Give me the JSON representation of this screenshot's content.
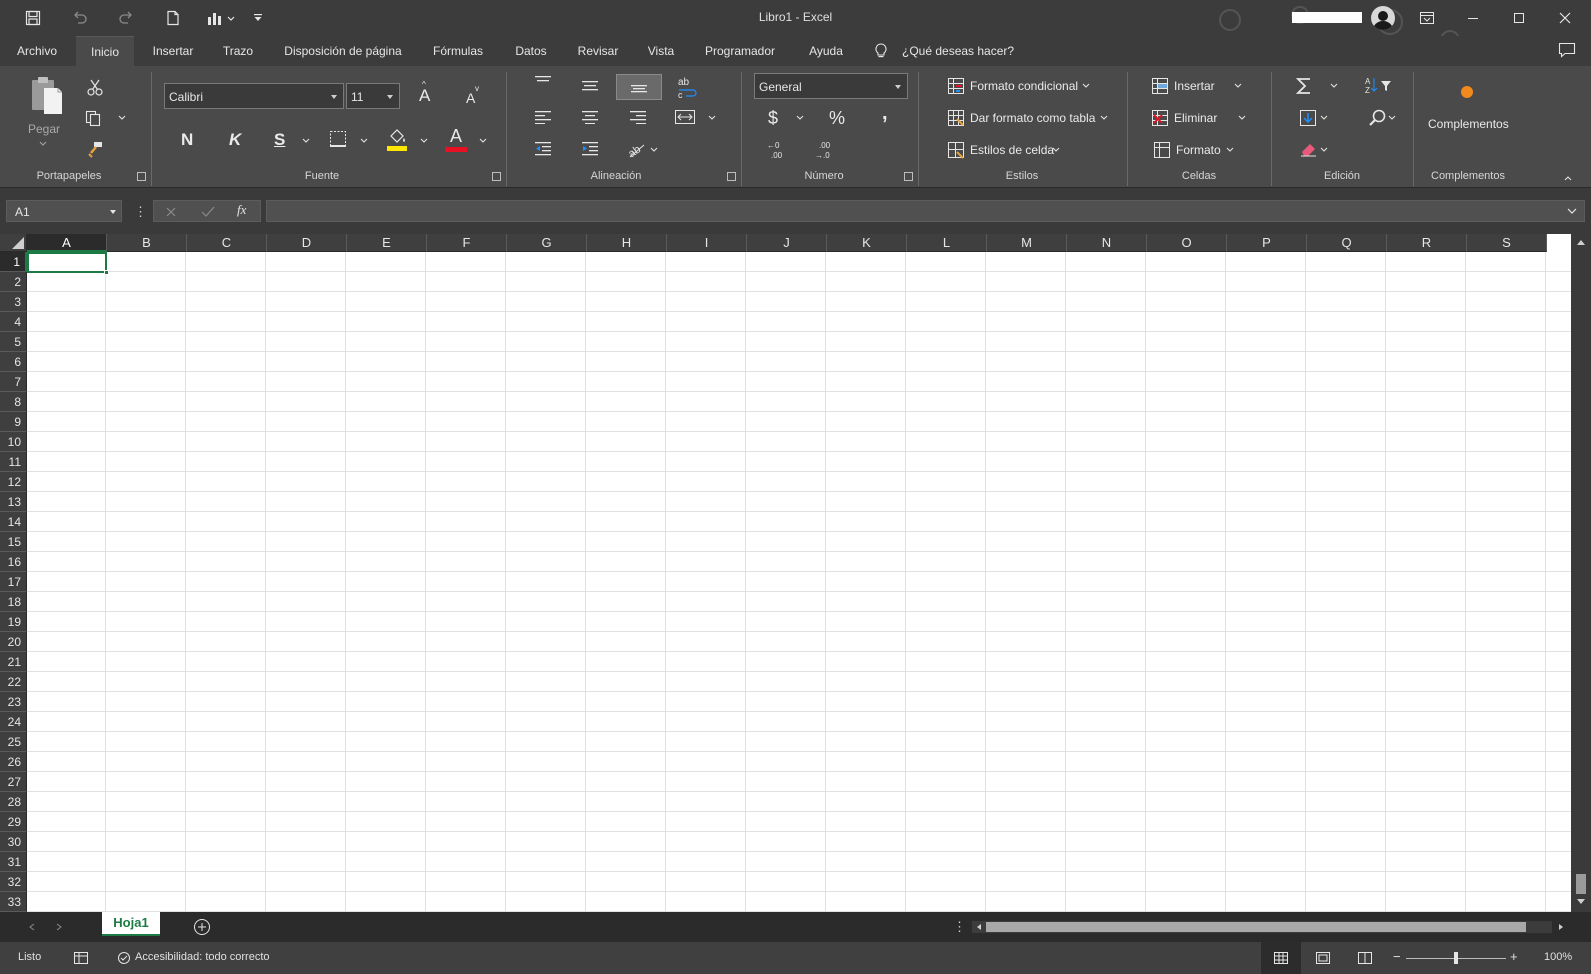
{
  "window": {
    "title": "Libro1  -  Excel"
  },
  "menu": {
    "tabs": [
      "Archivo",
      "Inicio",
      "Insertar",
      "Trazo",
      "Disposición de página",
      "Fórmulas",
      "Datos",
      "Revisar",
      "Vista",
      "Programador",
      "Ayuda"
    ],
    "active": "Inicio",
    "tell_me": "¿Qué deseas hacer?"
  },
  "ribbon": {
    "clipboard": {
      "label": "Portapapeles",
      "paste": "Pegar"
    },
    "font": {
      "label": "Fuente",
      "name": "Calibri",
      "size": "11",
      "bold": "N",
      "italic": "K",
      "underline": "S",
      "grow": "A",
      "shrink": "A",
      "color_letter": "A",
      "highlight_color": "#ffe600",
      "font_color": "#e81123"
    },
    "alignment": {
      "label": "Alineación"
    },
    "number": {
      "label": "Número",
      "format": "General",
      "currency": "$",
      "percent": "%",
      "comma": ","
    },
    "styles": {
      "label": "Estilos",
      "conditional": "Formato condicional",
      "as_table": "Dar formato como tabla",
      "cell_styles": "Estilos de celda"
    },
    "cells": {
      "label": "Celdas",
      "insert": "Insertar",
      "delete": "Eliminar",
      "format": "Formato"
    },
    "editing": {
      "label": "Edición"
    },
    "addins": {
      "label": "Complementos",
      "button": "Complementos",
      "dot_color": "#f08a1c"
    }
  },
  "formula_bar": {
    "name_box": "A1",
    "formula": "",
    "fx": "fx"
  },
  "grid": {
    "columns": [
      "A",
      "B",
      "C",
      "D",
      "E",
      "F",
      "G",
      "H",
      "I",
      "J",
      "K",
      "L",
      "M",
      "N",
      "O",
      "P",
      "Q",
      "R",
      "S"
    ],
    "rows": [
      "1",
      "2",
      "3",
      "4",
      "5",
      "6",
      "7",
      "8",
      "9",
      "10",
      "11",
      "12",
      "13",
      "14",
      "15",
      "16",
      "17",
      "18",
      "19",
      "20",
      "21",
      "22",
      "23",
      "24",
      "25",
      "26",
      "27",
      "28",
      "29",
      "30",
      "31",
      "32",
      "33"
    ],
    "active_cell": "A1",
    "accent_color": "#1d7a45"
  },
  "sheets": {
    "tabs": [
      "Hoja1"
    ],
    "active": "Hoja1"
  },
  "status": {
    "ready": "Listo",
    "accessibility": "Accesibilidad: todo correcto",
    "zoom": "100%"
  }
}
